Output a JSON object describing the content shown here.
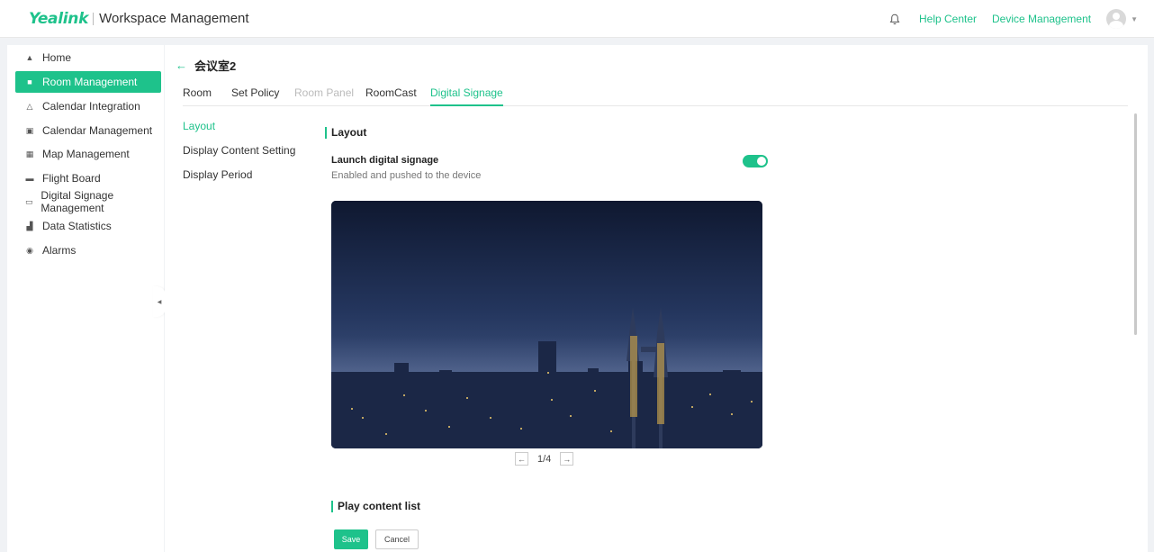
{
  "header": {
    "logo": "Yealink",
    "title": "Workspace Management",
    "links": [
      "Help Center",
      "Device Management"
    ],
    "icons": {
      "bell": "bell-icon",
      "avatar": "user-avatar-icon",
      "caret": "chevron-down-icon"
    },
    "accent_color": "#1ec28b"
  },
  "sidebar": {
    "items": [
      {
        "label": "Home",
        "icon": "home-icon",
        "active": false
      },
      {
        "label": "Room Management",
        "icon": "room-icon",
        "active": true
      },
      {
        "label": "Calendar Integration",
        "icon": "triangle-icon",
        "active": false
      },
      {
        "label": "Calendar Management",
        "icon": "calendar-icon",
        "active": false
      },
      {
        "label": "Map Management",
        "icon": "map-icon",
        "active": false
      },
      {
        "label": "Flight Board",
        "icon": "board-icon",
        "active": false
      },
      {
        "label": "Digital Signage Management",
        "icon": "signage-icon",
        "active": false
      },
      {
        "label": "Data Statistics",
        "icon": "bar-chart-icon",
        "active": false
      },
      {
        "label": "Alarms",
        "icon": "alarm-icon",
        "active": false
      }
    ]
  },
  "page": {
    "title": "会议室2",
    "tabs": [
      {
        "label": "Room",
        "state": "normal"
      },
      {
        "label": "Set Policy",
        "state": "normal"
      },
      {
        "label": "Room Panel",
        "state": "disabled"
      },
      {
        "label": "RoomCast",
        "state": "normal"
      },
      {
        "label": "Digital Signage",
        "state": "active"
      }
    ],
    "subnav": [
      "Layout",
      "Display Content Setting",
      "Display Period"
    ],
    "subnav_active": "Layout"
  },
  "layout_section": {
    "title": "Layout",
    "toggle_label": "Launch digital signage",
    "toggle_desc": "Enabled and pushed to the device",
    "toggle_on": true,
    "pager": "1/4"
  },
  "content_section": {
    "title": "Play content list"
  },
  "actions": {
    "save": "Save",
    "cancel": "Cancel"
  }
}
